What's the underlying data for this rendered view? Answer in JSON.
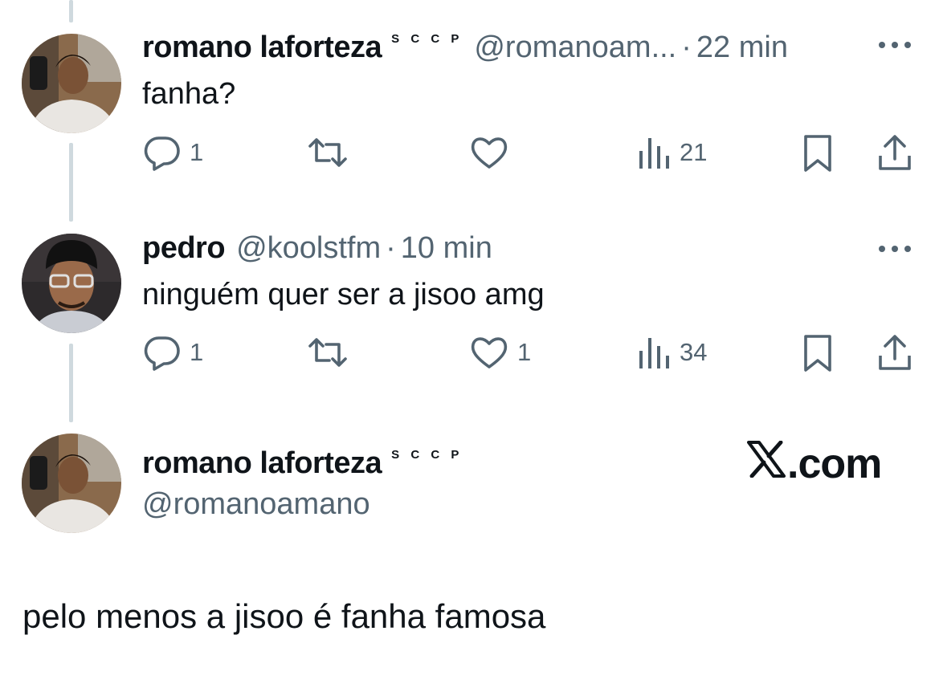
{
  "colors": {
    "text": "#0f1419",
    "secondary": "#536471",
    "thread_line": "#cfd9de",
    "background": "#ffffff"
  },
  "replies": [
    {
      "name": "romano laforteza",
      "badge": "S C C P",
      "handle": "@romanoam...",
      "separator": "·",
      "time": "22 min",
      "more": "•••",
      "text": "fanha?",
      "replies_count": "1",
      "retweets_count": "",
      "likes_count": "",
      "views_count": "21",
      "icons": [
        "reply-icon",
        "retweet-icon",
        "like-icon",
        "views-icon",
        "bookmark-icon",
        "share-icon"
      ]
    },
    {
      "name": "pedro",
      "handle": "@koolstfm",
      "separator": "·",
      "time": "10 min",
      "more": "•••",
      "text": "ninguém quer ser a jisoo amg",
      "replies_count": "1",
      "retweets_count": "",
      "likes_count": "1",
      "views_count": "34",
      "icons": [
        "reply-icon",
        "retweet-icon",
        "like-icon",
        "views-icon",
        "bookmark-icon",
        "share-icon"
      ]
    }
  ],
  "main_tweet": {
    "name": "romano laforteza",
    "badge": "S C C P",
    "handle": "@romanoamano",
    "site_label": ".com",
    "text": "pelo menos a jisoo é fanha famosa"
  }
}
